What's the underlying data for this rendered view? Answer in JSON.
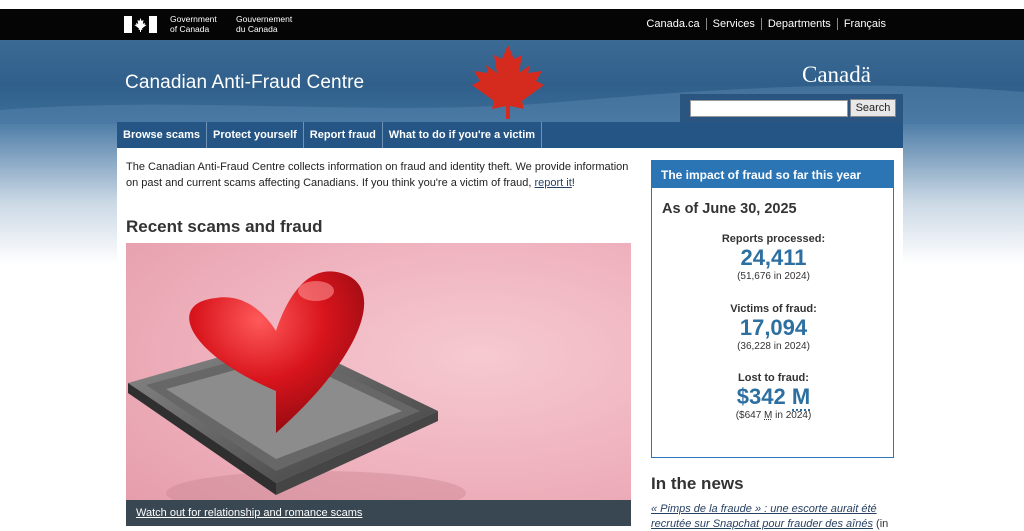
{
  "header": {
    "gov_en": [
      "Government",
      "of Canada"
    ],
    "gov_fr": [
      "Gouvernement",
      "du Canada"
    ],
    "links": [
      "Canada.ca",
      "Services",
      "Departments",
      "Français"
    ],
    "wordmark": "Canadä",
    "site_title": "Canadian Anti-Fraud Centre",
    "search_button": "Search",
    "search_placeholder": ""
  },
  "nav": [
    "Browse scams",
    "Protect yourself",
    "Report fraud",
    "What to do if you're a victim"
  ],
  "intro": {
    "text": "The Canadian Anti-Fraud Centre collects information on fraud and identity theft. We provide information on past and current scams affecting Canadians. If you think you're a victim of fraud, ",
    "link": "report it",
    "end": "!"
  },
  "recent": {
    "title": "Recent scams and fraud",
    "caption": "Watch out for relationship and romance scams"
  },
  "impact": {
    "title": "The impact of fraud so far this year",
    "as_of": "As of June 30, 2025",
    "stats": [
      {
        "label": "Reports processed:",
        "value": "24,411",
        "prev": "(51,676 in 2024)"
      },
      {
        "label": "Victims of fraud:",
        "value": "17,094",
        "prev": "(36,228 in 2024)"
      },
      {
        "label": "Lost to fraud:",
        "value": "$342",
        "unit": "M",
        "prev_pre": "($647 ",
        "prev_unit": "M",
        "prev_post": " in 2024)"
      }
    ]
  },
  "news": {
    "title": "In the news",
    "item_link": "« Pimps de la fraude » : une escorte aurait été recrutée sur Snapchat pour frauder des aînés",
    "item_tail": " (in"
  },
  "colors": {
    "nav": "#255584",
    "accent": "#2b75b5",
    "stat": "#2c6fa0",
    "leaf": "#d52b1e"
  }
}
